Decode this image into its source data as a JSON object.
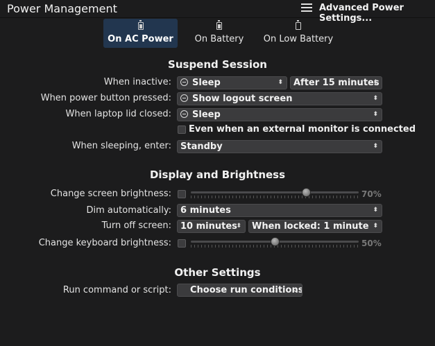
{
  "header": {
    "title": "Power Management",
    "advanced_label": "Advanced Power Settings..."
  },
  "tabs": [
    {
      "label": "On AC Power",
      "icon": "battery-charging-icon",
      "active": true
    },
    {
      "label": "On Battery",
      "icon": "battery-icon",
      "active": false
    },
    {
      "label": "On Low Battery",
      "icon": "battery-low-icon",
      "active": false
    }
  ],
  "suspend": {
    "title": "Suspend Session",
    "when_inactive_label": "When inactive:",
    "when_inactive_action": "Sleep",
    "when_inactive_delay": "After 15 minutes",
    "power_button_label": "When power button pressed:",
    "power_button_action": "Show logout screen",
    "lid_closed_label": "When laptop lid closed:",
    "lid_closed_action": "Sleep",
    "external_monitor_label": "Even when an external monitor is connected",
    "external_monitor_checked": false,
    "sleeping_enter_label": "When sleeping, enter:",
    "sleeping_enter_value": "Standby"
  },
  "display": {
    "title": "Display and Brightness",
    "screen_brightness_label": "Change screen brightness:",
    "screen_brightness_checked": false,
    "screen_brightness_value": 0.7,
    "screen_brightness_pct": "70%",
    "dim_label": "Dim automatically:",
    "dim_value": "6 minutes",
    "turn_off_label": "Turn off screen:",
    "turn_off_value": "10 minutes",
    "turn_off_locked_value": "When locked: 1 minute",
    "keyboard_brightness_label": "Change keyboard brightness:",
    "keyboard_brightness_checked": false,
    "keyboard_brightness_value": 0.5,
    "keyboard_brightness_pct": "50%"
  },
  "other": {
    "title": "Other Settings",
    "run_command_label": "Run command or script:",
    "run_command_button": "Choose run conditions"
  },
  "colors": {
    "background": "#1c1c1d",
    "active_tab": "#22364f",
    "combo_bg": "#3b3b3d"
  }
}
